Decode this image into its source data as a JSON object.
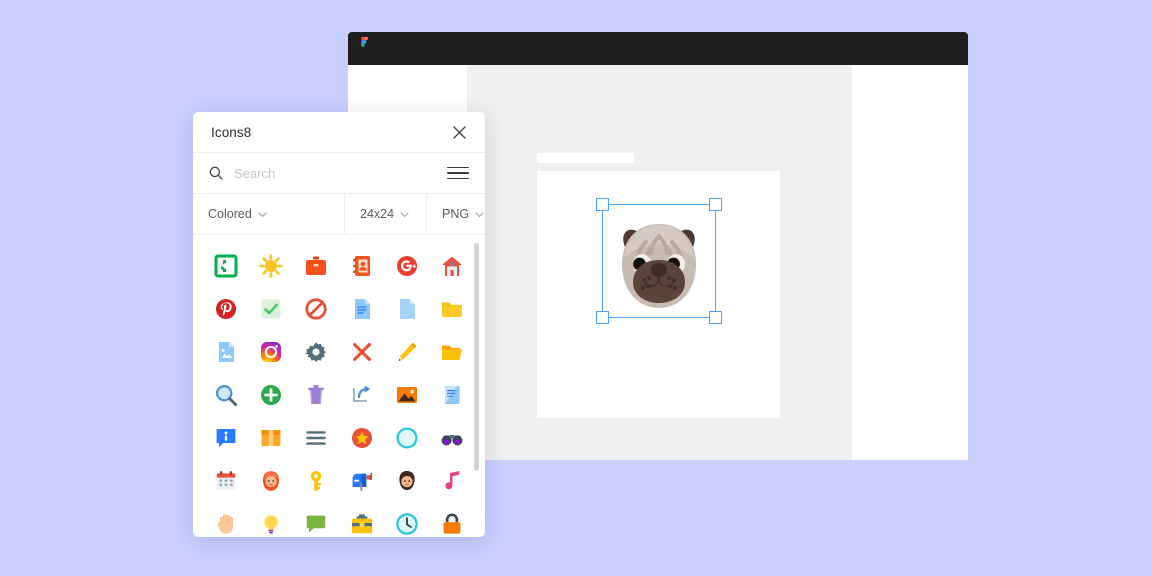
{
  "background_color": "#c8d0fd",
  "figma_window": {
    "toolbar_color": "#1e1e1e",
    "logo_name": "figma-logo",
    "canvas_bg": "#f0f0f0",
    "artboard_bg": "#ffffff",
    "selection_color": "#4da3f5",
    "selected_object": "pug-dog-face-illustration"
  },
  "plugin": {
    "title": "Icons8",
    "close_label": "×",
    "search": {
      "placeholder": "Search",
      "value": ""
    },
    "filters": {
      "style": "Colored",
      "size": "24x24",
      "format": "PNG"
    },
    "icons": [
      {
        "name": "puzzle-piece-icon",
        "color": "#00b050"
      },
      {
        "name": "sun-icon",
        "color": "#ffc31f"
      },
      {
        "name": "briefcase-icon",
        "color": "#f4511e"
      },
      {
        "name": "contacts-book-icon",
        "color": "#f4511e"
      },
      {
        "name": "google-plus-icon",
        "color": "#ee3d2e"
      },
      {
        "name": "home-icon",
        "color": "#e8503a"
      },
      {
        "name": "pinterest-icon",
        "color": "#d32323"
      },
      {
        "name": "checkmark-icon",
        "color": "#52c36a"
      },
      {
        "name": "no-entry-icon",
        "color": "#e8503a"
      },
      {
        "name": "document-lines-icon",
        "color": "#8fc8f5"
      },
      {
        "name": "blank-file-icon",
        "color": "#a3d4f7"
      },
      {
        "name": "folder-icon",
        "color": "#ffc107"
      },
      {
        "name": "image-file-icon",
        "color": "#8fc8f5"
      },
      {
        "name": "instagram-icon",
        "color": "#d6249f"
      },
      {
        "name": "settings-gear-icon",
        "color": "#546e7a"
      },
      {
        "name": "close-cross-icon",
        "color": "#e8503a"
      },
      {
        "name": "pencil-icon",
        "color": "#ffc107"
      },
      {
        "name": "open-folder-icon",
        "color": "#ffc107"
      },
      {
        "name": "magnifier-icon",
        "color": "#4a90d9"
      },
      {
        "name": "add-circle-icon",
        "color": "#2ba84a"
      },
      {
        "name": "trash-bin-icon",
        "color": "#9c7fd4"
      },
      {
        "name": "share-arrow-icon",
        "color": "#4a90d9"
      },
      {
        "name": "picture-icon",
        "color": "#f57c00"
      },
      {
        "name": "scroll-document-icon",
        "color": "#8fc8f5"
      },
      {
        "name": "info-bubble-icon",
        "color": "#2979ff"
      },
      {
        "name": "package-box-icon",
        "color": "#ffa726"
      },
      {
        "name": "menu-lines-icon",
        "color": "#546e7a"
      },
      {
        "name": "star-badge-icon",
        "color": "#e8503a"
      },
      {
        "name": "circle-outline-icon",
        "color": "#26c6da"
      },
      {
        "name": "binoculars-icon",
        "color": "#7b1fa2"
      },
      {
        "name": "calendar-icon",
        "color": "#e8503a"
      },
      {
        "name": "woman-avatar-icon",
        "color": "#f4511e"
      },
      {
        "name": "key-icon",
        "color": "#ffc107"
      },
      {
        "name": "mailbox-icon",
        "color": "#2979ff"
      },
      {
        "name": "man-avatar-icon",
        "color": "#3e2723"
      },
      {
        "name": "music-note-icon",
        "color": "#ec407a"
      },
      {
        "name": "hand-icon",
        "color": "#ffcc99"
      },
      {
        "name": "lightbulb-icon",
        "color": "#ffd54f"
      },
      {
        "name": "speech-bubble-icon",
        "color": "#7cb342"
      },
      {
        "name": "toolbox-icon",
        "color": "#ffc107"
      },
      {
        "name": "clock-icon",
        "color": "#26c6da"
      },
      {
        "name": "padlock-icon",
        "color": "#f57c00"
      }
    ]
  }
}
